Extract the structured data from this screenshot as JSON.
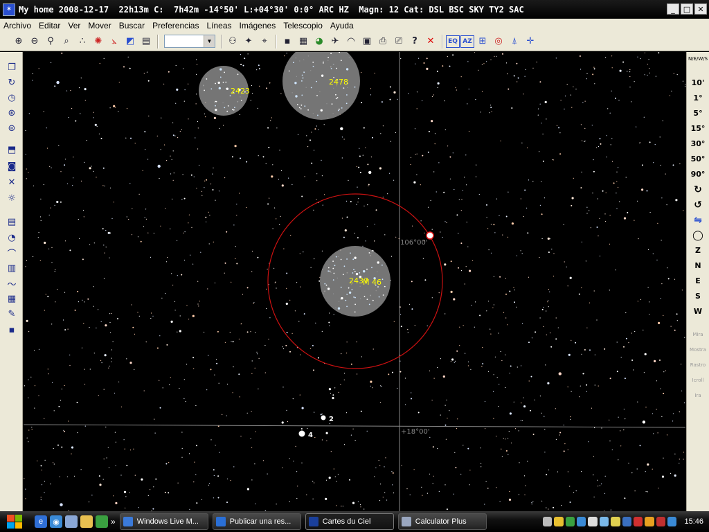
{
  "window": {
    "title": "My home 2008-12-17  22h13m C:  7h42m -14°50' L:+04°30' 0:0° ARC HZ  Magn: 12 Cat: DSL BSC SKY TY2 SAC",
    "minimize": "_",
    "maximize": "□",
    "close": "✕"
  },
  "menu": [
    "Archivo",
    "Editar",
    "Ver",
    "Mover",
    "Buscar",
    "Preferencias",
    "Líneas",
    "Imágenes",
    "Telescopio",
    "Ayuda"
  ],
  "toolbar": {
    "combo_value": "",
    "combo_arrow": "▼",
    "buttons_left": [
      "zoom-in-icon",
      "zoom-out-icon",
      "zoom-window-icon",
      "search-magnifier-icon",
      "symbol-icon",
      "planet-icon",
      "line-icon",
      "gradient-icon",
      "page-icon"
    ],
    "glyphs_left": [
      "⊕",
      "⊖",
      "⚲",
      "⌕",
      "∴",
      "✺",
      "⦛",
      "◩",
      "▤"
    ],
    "buttons_mid": [
      "binoculars-icon",
      "find-star-icon",
      "find-object-icon"
    ],
    "glyphs_mid": [
      "⚇",
      "✦",
      "⌖"
    ],
    "buttons_right": [
      "save-icon",
      "list-icon",
      "globe-icon",
      "satellite-icon",
      "gauge-icon",
      "calendar-icon",
      "print-icon",
      "print-setup-icon"
    ],
    "glyphs_right": [
      "▪",
      "▦",
      "◕",
      "✈",
      "◠",
      "▣",
      "⎙",
      "⎚"
    ],
    "help": "?",
    "close": "✕",
    "eq_label": "EQ",
    "az_label": "AZ",
    "mode_buttons": [
      "ecliptic-icon",
      "target-icon",
      "constellation-icon",
      "field-icon"
    ],
    "mode_glyphs": [
      "⊞",
      "◎",
      "⍋",
      "✛"
    ]
  },
  "left_toolbar": {
    "icons": [
      "copy-icon",
      "refresh-icon",
      "clock-icon",
      "globe-grid-icon",
      "mount-icon",
      "dss-icon",
      "camera-icon",
      "dna-icon",
      "bulb-icon",
      "layers-icon",
      "compass-icon",
      "telescope-icon",
      "chart-icon",
      "graph-icon",
      "notes-icon",
      "tools-icon",
      "plugin-icon"
    ],
    "glyphs": [
      "❐",
      "↻",
      "◷",
      "⊛",
      "⊜",
      "⬒",
      "◙",
      "✕",
      "☼",
      "▤",
      "◔",
      "⌒",
      "▥",
      "〜",
      "▦",
      "✎",
      "▪"
    ]
  },
  "right_toolbar": {
    "compass_rose": "N/E/W/S",
    "fov": [
      "10'",
      "1°",
      "5°",
      "15°",
      "30°",
      "50°",
      "90°"
    ],
    "directions": [
      "Z",
      "N",
      "E",
      "S",
      "W"
    ],
    "faded": [
      "Mira",
      "Mostra",
      "Rastro",
      "Icroll",
      "Ira"
    ],
    "icon_names": [
      "rotate-cw-icon",
      "rotate-ccw-icon",
      "flip-icon",
      "circle-icon"
    ],
    "icon_glyphs": [
      "↻",
      "↺",
      "⇋",
      "◯"
    ]
  },
  "sky": {
    "objects": [
      {
        "label": "2423"
      },
      {
        "label": "2478"
      },
      {
        "label": "2437"
      },
      {
        "label": "M 46"
      }
    ],
    "grid_labels": [
      "106°00'",
      "+18°00'"
    ],
    "star_labels": [
      "2",
      "4"
    ],
    "colors": {
      "object_label": "#ffff00",
      "telrad": "#cc1111",
      "cluster_disc": "#8a8a8a",
      "grid": "#888888"
    }
  },
  "taskbar": {
    "tasks": [
      {
        "label": "Windows Live M...",
        "color": "#3b7ad9"
      },
      {
        "label": "Publicar una res...",
        "color": "#2a6fd6"
      },
      {
        "label": "Cartes du Ciel",
        "color": "#1a3f9a"
      },
      {
        "label": "Calculator Plus",
        "color": "#9aa7c0"
      }
    ],
    "clock": "15:46",
    "more": "»"
  }
}
